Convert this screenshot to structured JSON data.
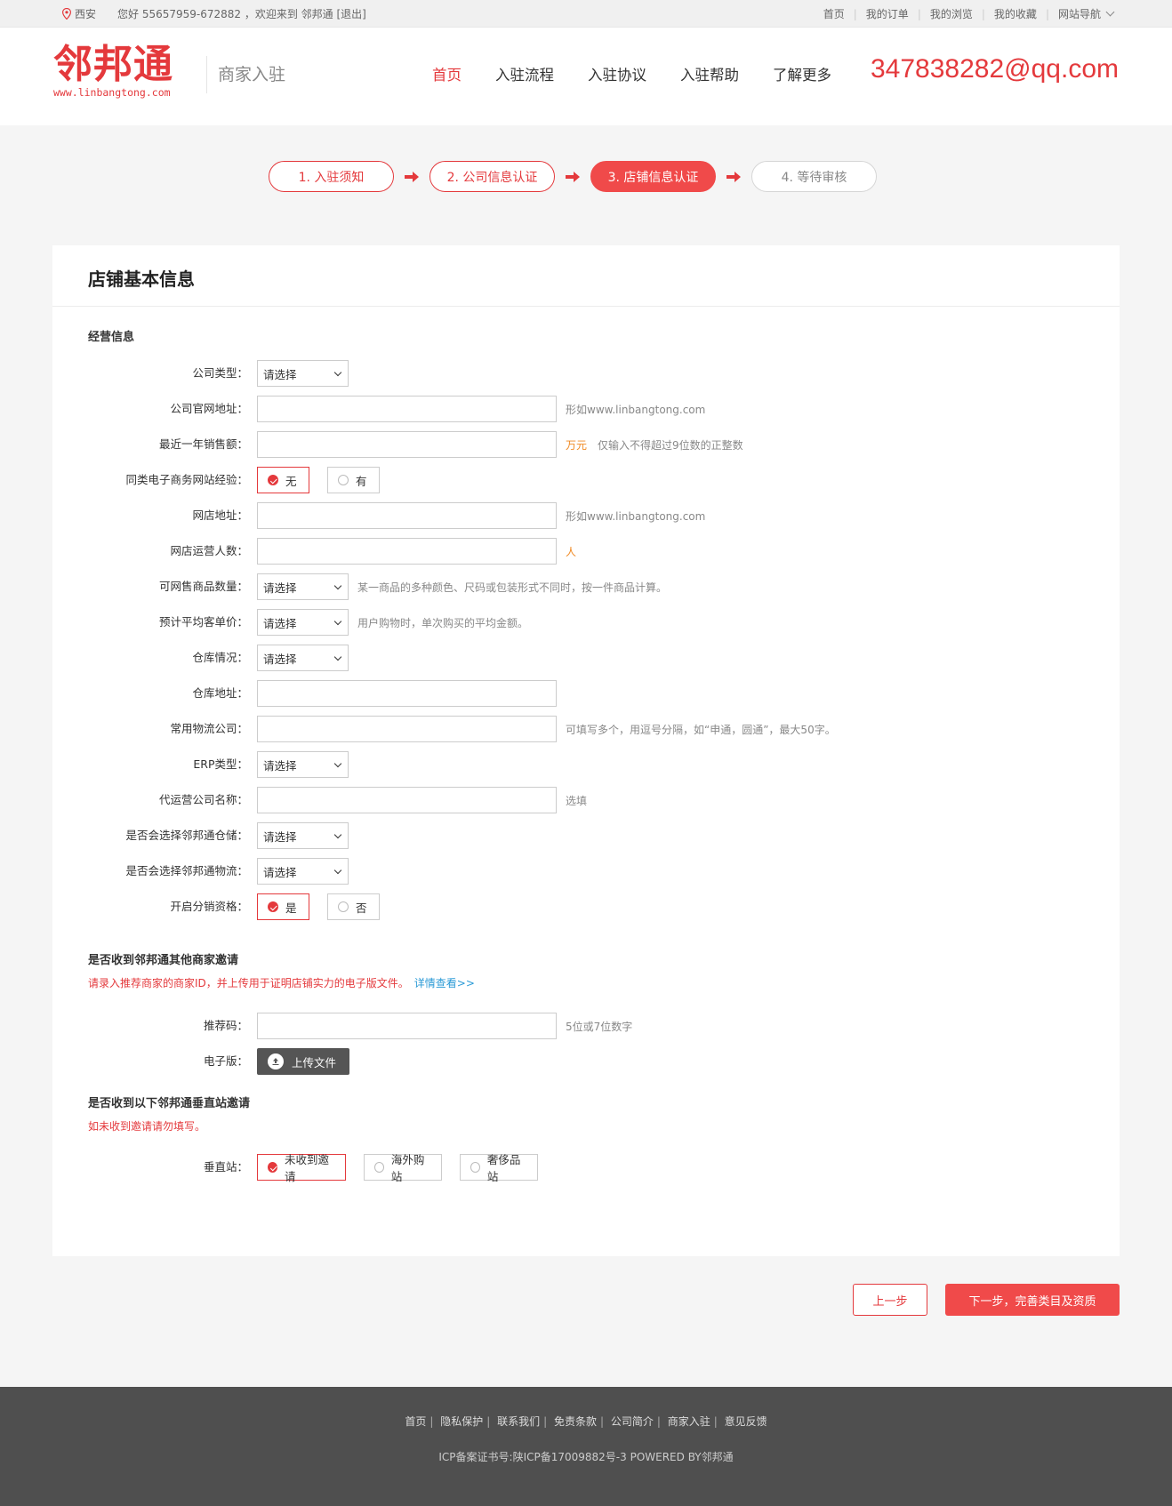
{
  "topbar": {
    "city": "西安",
    "greeting": "您好  55657959-672882  ，欢迎来到 邻邦通 [退出]",
    "links": [
      "首页",
      "我的订单",
      "我的浏览",
      "我的收藏",
      "网站导航"
    ]
  },
  "header": {
    "logo_text": "邻邦通",
    "logo_url": "www.linbangtong.com",
    "subtitle": "商家入驻",
    "nav": [
      "首页",
      "入驻流程",
      "入驻协议",
      "入驻帮助",
      "了解更多"
    ],
    "contact_email": "347838282@qq.com"
  },
  "steps": [
    {
      "label": "1. 入驻须知",
      "state": "done"
    },
    {
      "label": "2. 公司信息认证",
      "state": "done"
    },
    {
      "label": "3. 店铺信息认证",
      "state": "active"
    },
    {
      "label": "4. 等待审核",
      "state": "pending"
    }
  ],
  "form": {
    "card_title": "店铺基本信息",
    "section1_title": "经营信息",
    "select_placeholder": "请选择",
    "fields": {
      "company_type": "公司类型：",
      "company_site": "公司官网地址：",
      "company_site_hint": "形如www.linbangtong.com",
      "annual_sales": "最近一年销售额：",
      "annual_sales_unit": "万元",
      "annual_sales_hint": "仅输入不得超过9位数的正整数",
      "ecommerce_exp": "同类电子商务网站经验：",
      "ecommerce_exp_no": "无",
      "ecommerce_exp_yes": "有",
      "shop_url": "网店地址：",
      "shop_url_hint": "形如www.linbangtong.com",
      "staff_count": "网店运营人数：",
      "staff_count_unit": "人",
      "product_count": "可网售商品数量：",
      "product_count_hint": "某一商品的多种颜色、尺码或包装形式不同时，按一件商品计算。",
      "avg_price": "预计平均客单价：",
      "avg_price_hint": "用户购物时，单次购买的平均金额。",
      "warehouse": "仓库情况：",
      "warehouse_addr": "仓库地址：",
      "logistics": "常用物流公司：",
      "logistics_hint": "可填写多个，用逗号分隔，如“申通，圆通”，最大50字。",
      "erp_type": "ERP类型：",
      "agency_name": "代运营公司名称：",
      "agency_hint": "选填",
      "use_storage": "是否会选择邻邦通仓储：",
      "use_logistics": "是否会选择邻邦通物流：",
      "distribution": "开启分销资格：",
      "distribution_yes": "是",
      "distribution_no": "否"
    },
    "section2_title": "是否收到邻邦通其他商家邀请",
    "section2_note": "请录入推荐商家的商家ID，并上传用于证明店铺实力的电子版文件。",
    "section2_link": "详情查看>>",
    "referral_code": "推荐码：",
    "referral_hint": "5位或7位数字",
    "electronic": "电子版：",
    "upload_label": "上传文件",
    "section3_title": "是否收到以下邻邦通垂直站邀请",
    "section3_note": "如未收到邀请请勿填写。",
    "vertical_label": "垂直站：",
    "vertical_options": [
      "未收到邀请",
      "海外购站",
      "奢侈品站"
    ]
  },
  "buttons": {
    "prev": "上一步",
    "next": "下一步，完善类目及资质"
  },
  "footer": {
    "links": [
      "首页",
      "隐私保护",
      "联系我们",
      "免责条款",
      "公司简介",
      "商家入驻",
      "意见反馈"
    ],
    "icp": "ICP备案证书号:陕ICP备17009882号-3 POWERED BY邻邦通"
  },
  "colors": {
    "accent": "#e4393c",
    "accent_button": "#f04a4a",
    "footer_bg": "#4f4f4f"
  }
}
